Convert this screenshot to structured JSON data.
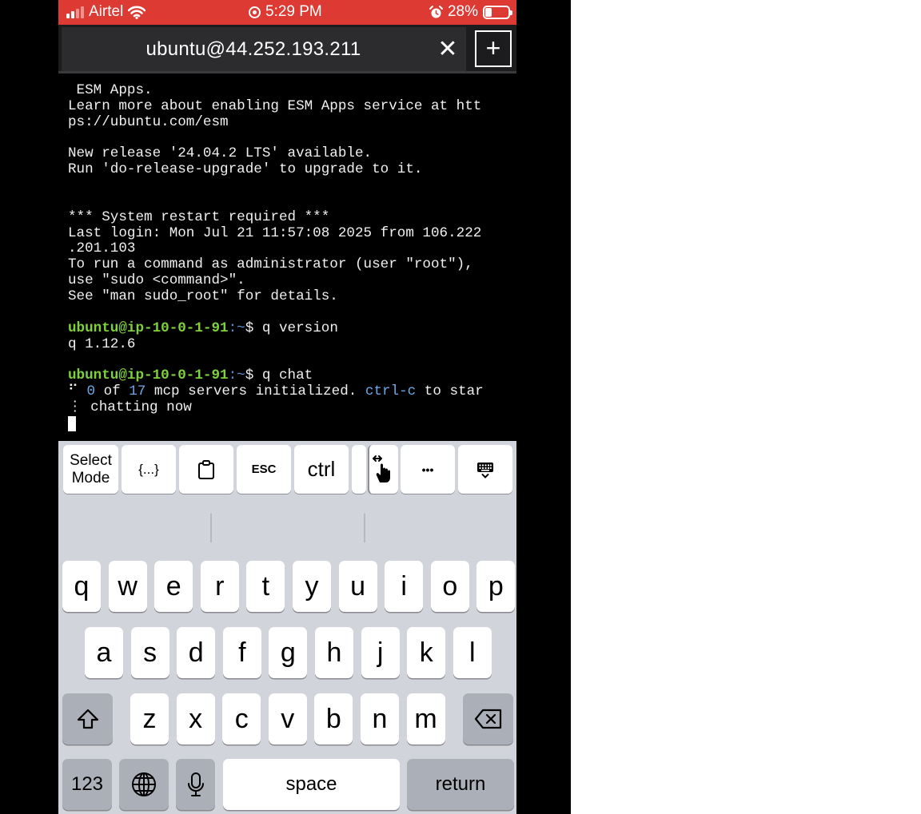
{
  "status_bar": {
    "carrier": "Airtel",
    "time": "5:29 PM",
    "battery_percent": "28%",
    "battery_level": 0.28,
    "icons": [
      "signal-icon",
      "wifi-icon",
      "screen-record-icon",
      "alarm-icon",
      "battery-icon"
    ],
    "bar_color": "#dc3a33"
  },
  "tab_bar": {
    "title": "ubuntu@44.252.193.211",
    "close_glyph": "✕",
    "add_glyph": "+"
  },
  "terminal": {
    "lines": [
      [
        {
          "t": " ESM Apps.",
          "c": "text"
        }
      ],
      [
        {
          "t": "Learn more about enabling ESM Apps service at htt",
          "c": "text"
        }
      ],
      [
        {
          "t": "ps://ubuntu.com/esm",
          "c": "text"
        }
      ],
      [
        {
          "t": "",
          "c": "text"
        }
      ],
      [
        {
          "t": "New release '24.04.2 LTS' available.",
          "c": "text"
        }
      ],
      [
        {
          "t": "Run 'do-release-upgrade' to upgrade to it.",
          "c": "text"
        }
      ],
      [
        {
          "t": "",
          "c": "text"
        }
      ],
      [
        {
          "t": "",
          "c": "text"
        }
      ],
      [
        {
          "t": "*** System restart required ***",
          "c": "text"
        }
      ],
      [
        {
          "t": "Last login: Mon Jul 21 11:57:08 2025 from 106.222",
          "c": "text"
        }
      ],
      [
        {
          "t": ".201.103",
          "c": "text"
        }
      ],
      [
        {
          "t": "To run a command as administrator (user \"root\"),",
          "c": "text"
        }
      ],
      [
        {
          "t": "use \"sudo <command>\".",
          "c": "text"
        }
      ],
      [
        {
          "t": "See \"man sudo_root\" for details.",
          "c": "text"
        }
      ],
      [
        {
          "t": "",
          "c": "text"
        }
      ],
      [
        {
          "t": "ubuntu@ip-10-0-1-91",
          "c": "user"
        },
        {
          "t": ":~",
          "c": "path"
        },
        {
          "t": "$ q version",
          "c": "text"
        }
      ],
      [
        {
          "t": "q 1.12.6",
          "c": "text"
        }
      ],
      [
        {
          "t": "",
          "c": "text"
        }
      ],
      [
        {
          "t": "ubuntu@ip-10-0-1-91",
          "c": "user"
        },
        {
          "t": ":~",
          "c": "path"
        },
        {
          "t": "$ q chat",
          "c": "text"
        }
      ],
      [
        {
          "t": "⠋ ",
          "c": "text"
        },
        {
          "t": "0",
          "c": "blue"
        },
        {
          "t": " of ",
          "c": "text"
        },
        {
          "t": "17",
          "c": "blue"
        },
        {
          "t": " mcp servers initialized. ",
          "c": "text"
        },
        {
          "t": "ctrl-c",
          "c": "blue"
        },
        {
          "t": " to star",
          "c": "text"
        }
      ],
      [
        {
          "t": "⋮ chatting now",
          "c": "text"
        }
      ]
    ],
    "colors": {
      "user": "#7fd13b",
      "path": "#5b8fd6",
      "blue": "#6fa8e6",
      "text": "#f0f0f0"
    }
  },
  "accessory_bar": {
    "select_mode": [
      "Select",
      "Mode"
    ],
    "braces": "{...}",
    "esc": "ESC",
    "ctrl": "ctrl",
    "more": "•••",
    "icons": [
      "clipboard-icon",
      "touch-pan-icon",
      "keyboard-hide-icon"
    ]
  },
  "keyboard": {
    "row1": [
      "q",
      "w",
      "e",
      "r",
      "t",
      "y",
      "u",
      "i",
      "o",
      "p"
    ],
    "row2": [
      "a",
      "s",
      "d",
      "f",
      "g",
      "h",
      "j",
      "k",
      "l"
    ],
    "row3": [
      "z",
      "x",
      "c",
      "v",
      "b",
      "n",
      "m"
    ],
    "numbers_label": "123",
    "space_label": "space",
    "return_label": "return",
    "icons": [
      "shift-icon",
      "backspace-icon",
      "globe-icon",
      "microphone-icon"
    ]
  }
}
